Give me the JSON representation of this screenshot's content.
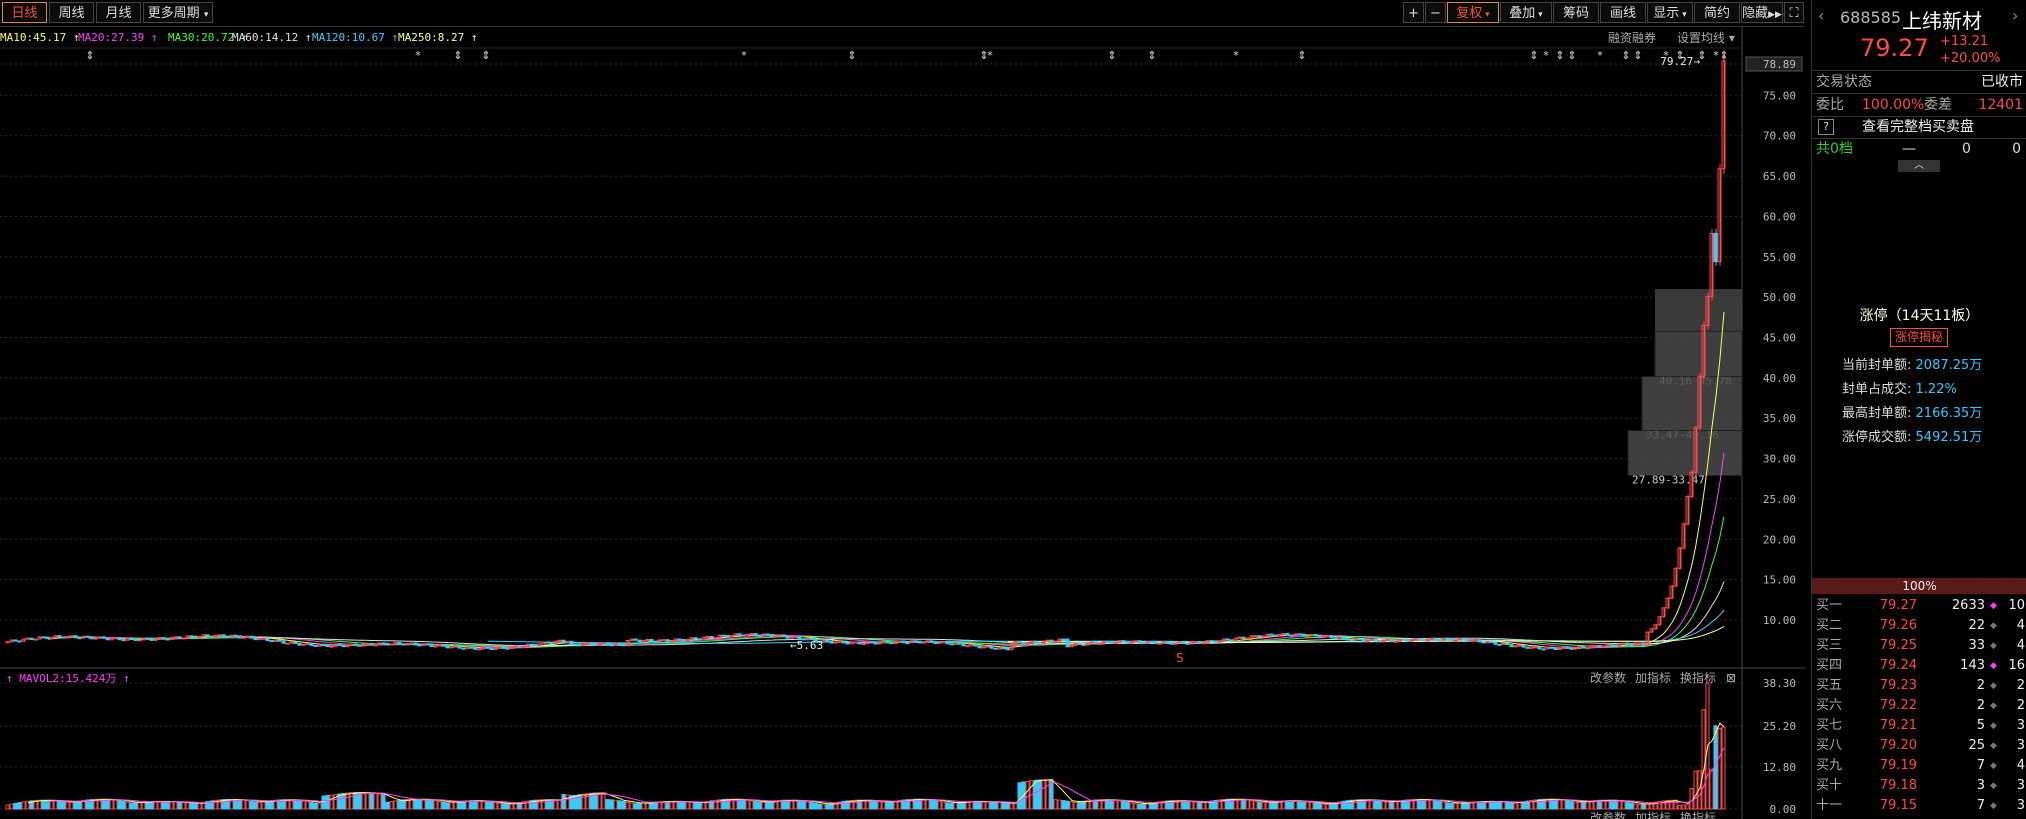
{
  "toolbar": {
    "periods": [
      "日线",
      "周线",
      "月线",
      "更多周期"
    ],
    "right_buttons": [
      "+",
      "−",
      "复权",
      "叠加",
      "筹码",
      "画线",
      "显示",
      "简约",
      "隐藏"
    ]
  },
  "ma_legend": [
    {
      "label": "MA10:45.17",
      "color": "#ffff55"
    },
    {
      "label": "MA20:27.39",
      "color": "#ff40ff"
    },
    {
      "label": "MA30:20.72",
      "color": "#40ff40"
    },
    {
      "label": "MA60:14.12",
      "color": "#e0e0e0"
    },
    {
      "label": "MA120:10.67",
      "color": "#40d0ff"
    },
    {
      "label": "MA250:8.27",
      "color": "#ffff99"
    }
  ],
  "chart_links": {
    "margin": "融资融券",
    "ma_settings": "设置均线"
  },
  "price_axis": [
    "78.89",
    "75.00",
    "70.00",
    "65.00",
    "60.00",
    "55.00",
    "50.00",
    "45.00",
    "40.00",
    "35.00",
    "30.00",
    "25.00",
    "20.00",
    "15.00",
    "10.00"
  ],
  "annotations": {
    "high": "79.27",
    "low": "5.63",
    "zone1": "40.16-45.78",
    "zone2": "33.47-40.16",
    "zone3": "27.89-33.47",
    "marker": "S"
  },
  "volume": {
    "legend": "MAVOL2:15.424万",
    "links": [
      "改参数",
      "加指标",
      "换指标"
    ],
    "axis": [
      "38.30",
      "25.20",
      "12.80",
      "0.00"
    ],
    "bottom_links": [
      "改参数",
      "加指标",
      "换指标"
    ]
  },
  "stock": {
    "code": "688585",
    "name": "上纬新材",
    "price": "79.27",
    "change": "+13.21",
    "change_pct": "+20.00%"
  },
  "status": {
    "label": "交易状态",
    "value": "已收市"
  },
  "ratio": {
    "wb_label": "委比",
    "wb_value": "100.00%",
    "wc_label": "委差",
    "wc_value": "12401"
  },
  "full_book": {
    "help": "?",
    "label": "查看完整档买卖盘"
  },
  "total_levels": {
    "label": "共0档",
    "dash": "—",
    "v1": "0",
    "v2": "0"
  },
  "limit_up": {
    "title": "涨停（14天11板）",
    "button": "涨停揭秘",
    "rows": [
      {
        "label": "当前封单额:",
        "value": "2087.25万"
      },
      {
        "label": "封单占成交:",
        "value": "1.22%"
      },
      {
        "label": "最高封单额:",
        "value": "2166.35万"
      },
      {
        "label": "涨停成交额:",
        "value": "5492.51万"
      }
    ]
  },
  "bid_ratio": "100%",
  "bids": [
    {
      "name": "买一",
      "price": "79.27",
      "vol": "2633",
      "dot": "◆",
      "n": "10"
    },
    {
      "name": "买二",
      "price": "79.26",
      "vol": "22",
      "dot": "◆",
      "n": "4"
    },
    {
      "name": "买三",
      "price": "79.25",
      "vol": "33",
      "dot": "◆",
      "n": "4"
    },
    {
      "name": "买四",
      "price": "79.24",
      "vol": "143",
      "dot": "◆",
      "n": "16"
    },
    {
      "name": "买五",
      "price": "79.23",
      "vol": "2",
      "dot": "◆",
      "n": "2"
    },
    {
      "name": "买六",
      "price": "79.22",
      "vol": "2",
      "dot": "◆",
      "n": "2"
    },
    {
      "name": "买七",
      "price": "79.21",
      "vol": "5",
      "dot": "◆",
      "n": "3"
    },
    {
      "name": "买八",
      "price": "79.20",
      "vol": "25",
      "dot": "◆",
      "n": "3"
    },
    {
      "name": "买九",
      "price": "79.19",
      "vol": "7",
      "dot": "◆",
      "n": "4"
    },
    {
      "name": "买十",
      "price": "79.18",
      "vol": "3",
      "dot": "◆",
      "n": "3"
    },
    {
      "name": "十一",
      "price": "79.15",
      "vol": "7",
      "dot": "◆",
      "n": "3"
    }
  ],
  "chart_data": {
    "type": "candlestick",
    "ylim": [
      5,
      80
    ],
    "recent_closes": [
      8.5,
      8.9,
      9.4,
      10.4,
      11.5,
      12.7,
      14.2,
      16.4,
      18.9,
      21.9,
      25.3,
      28.3,
      33.8,
      40.2,
      46.5,
      50.1,
      57.9,
      54.4,
      65.9,
      79.27
    ],
    "recent_volumes": [
      1.0,
      1.2,
      1.5,
      6.2,
      11.5,
      11.6,
      30.2,
      38.3,
      12.1,
      25.3,
      24.5,
      24.9
    ]
  }
}
